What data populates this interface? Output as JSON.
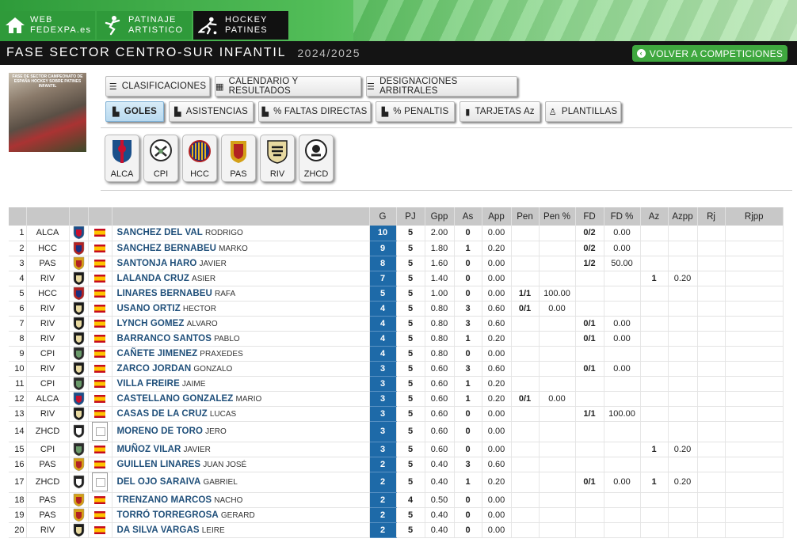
{
  "nav": {
    "tabs": [
      {
        "line1": "WEB",
        "line2": "FEDEXPA.es",
        "icon": "home-icon"
      },
      {
        "line1": "PATINAJE",
        "line2": "ARTISTICO",
        "icon": "skater-icon"
      },
      {
        "line1": "HOCKEY",
        "line2": "PATINES",
        "icon": "hockey-player-icon"
      }
    ]
  },
  "header": {
    "title": "FASE SECTOR CENTRO-SUR INFANTIL",
    "season": "2024/2025",
    "back_label": "VOLVER A COMPETICIONES"
  },
  "poster": {
    "text": "FASE DE SECTOR CAMPEONATO DE ESPAÑA HOCKEY SOBRE PATINES INFANTIL"
  },
  "menu_row1": [
    {
      "label": "CLASIFICACIONES",
      "icon": "list-icon"
    },
    {
      "label": "CALENDARIO Y RESULTADOS",
      "icon": "calendar-icon"
    },
    {
      "label": "DESIGNACIONES ARBITRALES",
      "icon": "list-icon"
    }
  ],
  "menu_row2": [
    {
      "label": "GOLES",
      "icon": "chart-icon",
      "active": true
    },
    {
      "label": "ASISTENCIAS",
      "icon": "chart-icon"
    },
    {
      "label": "% FALTAS DIRECTAS",
      "icon": "chart-icon"
    },
    {
      "label": "% PENALTIS",
      "icon": "chart-icon"
    },
    {
      "label": "TARJETAS Az",
      "icon": "document-icon"
    },
    {
      "label": "PLANTILLAS",
      "icon": "person-icon"
    }
  ],
  "teams": [
    {
      "code": "ALCA",
      "color": "#1a4f8a",
      "accent": "#c8102e"
    },
    {
      "code": "CPI",
      "color": "#2b2b2b",
      "accent": "#6a9a6a"
    },
    {
      "code": "HCC",
      "color": "#b22222",
      "accent": "#1a2f80"
    },
    {
      "code": "PAS",
      "color": "#d4a017",
      "accent": "#b22222"
    },
    {
      "code": "RIV",
      "color": "#1a1a1a",
      "accent": "#e8d9a0"
    },
    {
      "code": "ZHCD",
      "color": "#222222",
      "accent": "#ffffff"
    }
  ],
  "table": {
    "headers": [
      "G",
      "PJ",
      "Gpp",
      "As",
      "App",
      "Pen",
      "Pen %",
      "FD",
      "FD %",
      "Az",
      "Azpp",
      "Rj",
      "Rjpp"
    ],
    "rows": [
      {
        "pos": "1",
        "team": "ALCA",
        "surname": "SANCHEZ DEL VAL",
        "given": "RODRIGO",
        "g": "10",
        "pj": "5",
        "gpp": "2.00",
        "as": "0",
        "app": "0.00",
        "pen": "",
        "penp": "",
        "fd": "0/2",
        "fdp": "0.00",
        "az": "",
        "azpp": "",
        "rj": "",
        "rjpp": "",
        "photo": false
      },
      {
        "pos": "2",
        "team": "HCC",
        "surname": "SANCHEZ BERNABEU",
        "given": "MARKO",
        "g": "9",
        "pj": "5",
        "gpp": "1.80",
        "as": "1",
        "app": "0.20",
        "pen": "",
        "penp": "",
        "fd": "0/2",
        "fdp": "0.00",
        "az": "",
        "azpp": "",
        "rj": "",
        "rjpp": "",
        "photo": false
      },
      {
        "pos": "3",
        "team": "PAS",
        "surname": "SANTONJA HARO",
        "given": "JAVIER",
        "g": "8",
        "pj": "5",
        "gpp": "1.60",
        "as": "0",
        "app": "0.00",
        "pen": "",
        "penp": "",
        "fd": "1/2",
        "fdp": "50.00",
        "az": "",
        "azpp": "",
        "rj": "",
        "rjpp": "",
        "photo": false
      },
      {
        "pos": "4",
        "team": "RIV",
        "surname": "LALANDA CRUZ",
        "given": "ASIER",
        "g": "7",
        "pj": "5",
        "gpp": "1.40",
        "as": "0",
        "app": "0.00",
        "pen": "",
        "penp": "",
        "fd": "",
        "fdp": "",
        "az": "1",
        "azpp": "0.20",
        "rj": "",
        "rjpp": "",
        "photo": false
      },
      {
        "pos": "5",
        "team": "HCC",
        "surname": "LINARES BERNABEU",
        "given": "RAFA",
        "g": "5",
        "pj": "5",
        "gpp": "1.00",
        "as": "0",
        "app": "0.00",
        "pen": "1/1",
        "penp": "100.00",
        "fd": "",
        "fdp": "",
        "az": "",
        "azpp": "",
        "rj": "",
        "rjpp": "",
        "photo": false
      },
      {
        "pos": "6",
        "team": "RIV",
        "surname": "USANO ORTIZ",
        "given": "HECTOR",
        "g": "4",
        "pj": "5",
        "gpp": "0.80",
        "as": "3",
        "app": "0.60",
        "pen": "0/1",
        "penp": "0.00",
        "fd": "",
        "fdp": "",
        "az": "",
        "azpp": "",
        "rj": "",
        "rjpp": "",
        "photo": false
      },
      {
        "pos": "7",
        "team": "RIV",
        "surname": "LYNCH GOMEZ",
        "given": "ALVARO",
        "g": "4",
        "pj": "5",
        "gpp": "0.80",
        "as": "3",
        "app": "0.60",
        "pen": "",
        "penp": "",
        "fd": "0/1",
        "fdp": "0.00",
        "az": "",
        "azpp": "",
        "rj": "",
        "rjpp": "",
        "photo": false
      },
      {
        "pos": "8",
        "team": "RIV",
        "surname": "BARRANCO SANTOS",
        "given": "PABLO",
        "g": "4",
        "pj": "5",
        "gpp": "0.80",
        "as": "1",
        "app": "0.20",
        "pen": "",
        "penp": "",
        "fd": "0/1",
        "fdp": "0.00",
        "az": "",
        "azpp": "",
        "rj": "",
        "rjpp": "",
        "photo": false
      },
      {
        "pos": "9",
        "team": "CPI",
        "surname": "CAÑETE JIMENEZ",
        "given": "PRAXEDES",
        "g": "4",
        "pj": "5",
        "gpp": "0.80",
        "as": "0",
        "app": "0.00",
        "pen": "",
        "penp": "",
        "fd": "",
        "fdp": "",
        "az": "",
        "azpp": "",
        "rj": "",
        "rjpp": "",
        "photo": false
      },
      {
        "pos": "10",
        "team": "RIV",
        "surname": "ZARCO JORDAN",
        "given": "GONZALO",
        "g": "3",
        "pj": "5",
        "gpp": "0.60",
        "as": "3",
        "app": "0.60",
        "pen": "",
        "penp": "",
        "fd": "0/1",
        "fdp": "0.00",
        "az": "",
        "azpp": "",
        "rj": "",
        "rjpp": "",
        "photo": false
      },
      {
        "pos": "11",
        "team": "CPI",
        "surname": "VILLA FREIRE",
        "given": "JAIME",
        "g": "3",
        "pj": "5",
        "gpp": "0.60",
        "as": "1",
        "app": "0.20",
        "pen": "",
        "penp": "",
        "fd": "",
        "fdp": "",
        "az": "",
        "azpp": "",
        "rj": "",
        "rjpp": "",
        "photo": false
      },
      {
        "pos": "12",
        "team": "ALCA",
        "surname": "CASTELLANO GONZALEZ",
        "given": "MARIO",
        "g": "3",
        "pj": "5",
        "gpp": "0.60",
        "as": "1",
        "app": "0.20",
        "pen": "0/1",
        "penp": "0.00",
        "fd": "",
        "fdp": "",
        "az": "",
        "azpp": "",
        "rj": "",
        "rjpp": "",
        "photo": false
      },
      {
        "pos": "13",
        "team": "RIV",
        "surname": "CASAS DE LA CRUZ",
        "given": "LUCAS",
        "g": "3",
        "pj": "5",
        "gpp": "0.60",
        "as": "0",
        "app": "0.00",
        "pen": "",
        "penp": "",
        "fd": "1/1",
        "fdp": "100.00",
        "az": "",
        "azpp": "",
        "rj": "",
        "rjpp": "",
        "photo": false
      },
      {
        "pos": "14",
        "team": "ZHCD",
        "surname": "MORENO DE TORO",
        "given": "JERO",
        "g": "3",
        "pj": "5",
        "gpp": "0.60",
        "as": "0",
        "app": "0.00",
        "pen": "",
        "penp": "",
        "fd": "",
        "fdp": "",
        "az": "",
        "azpp": "",
        "rj": "",
        "rjpp": "",
        "photo": true
      },
      {
        "pos": "15",
        "team": "CPI",
        "surname": "MUÑOZ VILAR",
        "given": "JAVIER",
        "g": "3",
        "pj": "5",
        "gpp": "0.60",
        "as": "0",
        "app": "0.00",
        "pen": "",
        "penp": "",
        "fd": "",
        "fdp": "",
        "az": "1",
        "azpp": "0.20",
        "rj": "",
        "rjpp": "",
        "photo": false
      },
      {
        "pos": "16",
        "team": "PAS",
        "surname": "GUILLEN LINARES",
        "given": "JUAN JOSÉ",
        "g": "2",
        "pj": "5",
        "gpp": "0.40",
        "as": "3",
        "app": "0.60",
        "pen": "",
        "penp": "",
        "fd": "",
        "fdp": "",
        "az": "",
        "azpp": "",
        "rj": "",
        "rjpp": "",
        "photo": false
      },
      {
        "pos": "17",
        "team": "ZHCD",
        "surname": "DEL OJO SARAIVA",
        "given": "GABRIEL",
        "g": "2",
        "pj": "5",
        "gpp": "0.40",
        "as": "1",
        "app": "0.20",
        "pen": "",
        "penp": "",
        "fd": "0/1",
        "fdp": "0.00",
        "az": "1",
        "azpp": "0.20",
        "rj": "",
        "rjpp": "",
        "photo": true
      },
      {
        "pos": "18",
        "team": "PAS",
        "surname": "TRENZANO MARCOS",
        "given": "NACHO",
        "g": "2",
        "pj": "4",
        "gpp": "0.50",
        "as": "0",
        "app": "0.00",
        "pen": "",
        "penp": "",
        "fd": "",
        "fdp": "",
        "az": "",
        "azpp": "",
        "rj": "",
        "rjpp": "",
        "photo": false
      },
      {
        "pos": "19",
        "team": "PAS",
        "surname": "TORRÓ TORREGROSA",
        "given": "GERARD",
        "g": "2",
        "pj": "5",
        "gpp": "0.40",
        "as": "0",
        "app": "0.00",
        "pen": "",
        "penp": "",
        "fd": "",
        "fdp": "",
        "az": "",
        "azpp": "",
        "rj": "",
        "rjpp": "",
        "photo": false
      },
      {
        "pos": "20",
        "team": "RIV",
        "surname": "DA SILVA VARGAS",
        "given": "LEIRE",
        "g": "2",
        "pj": "5",
        "gpp": "0.40",
        "as": "0",
        "app": "0.00",
        "pen": "",
        "penp": "",
        "fd": "",
        "fdp": "",
        "az": "",
        "azpp": "",
        "rj": "",
        "rjpp": "",
        "photo": false
      }
    ]
  }
}
